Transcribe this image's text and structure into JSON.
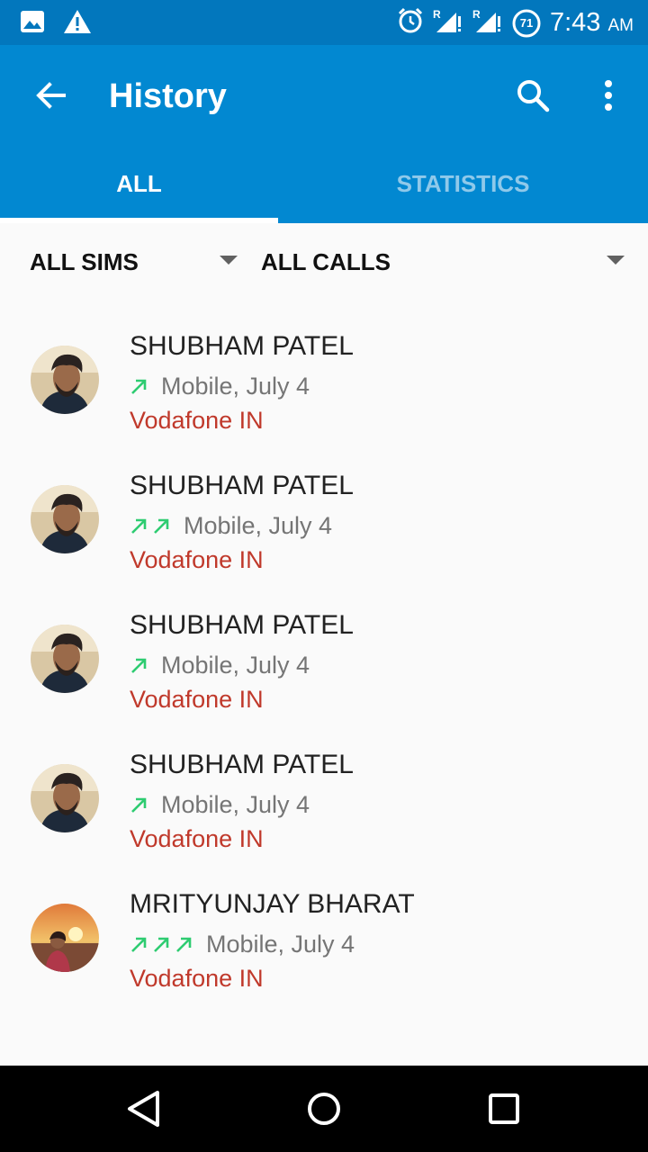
{
  "status_bar": {
    "time": "7:43",
    "ampm": "AM",
    "battery_level": "71",
    "left_icons": [
      "image-icon",
      "warning-icon"
    ],
    "right_icons": [
      "alarm-icon",
      "signal-icon",
      "signal-icon",
      "battery-icon"
    ]
  },
  "app_bar": {
    "title": "History",
    "icons": [
      "back-arrow-icon",
      "search-icon",
      "more-vert-icon"
    ]
  },
  "tabs": [
    {
      "label": "ALL",
      "selected": true
    },
    {
      "label": "STATISTICS",
      "selected": false
    }
  ],
  "filters": {
    "sims": "ALL SIMS",
    "calls": "ALL CALLS"
  },
  "calls": [
    {
      "name": "",
      "arrow_count": 2,
      "detail": "Mobile, July 4",
      "carrier": "Vodafone IN",
      "avatar": "sunset-photo"
    },
    {
      "name": "SHUBHAM PATEL",
      "arrow_count": 1,
      "detail": "Mobile, July 4",
      "carrier": "Vodafone IN",
      "avatar": "man-photo"
    },
    {
      "name": "SHUBHAM PATEL",
      "arrow_count": 2,
      "detail": "Mobile, July 4",
      "carrier": "Vodafone IN",
      "avatar": "man-photo"
    },
    {
      "name": "SHUBHAM PATEL",
      "arrow_count": 1,
      "detail": "Mobile, July 4",
      "carrier": "Vodafone IN",
      "avatar": "man-photo"
    },
    {
      "name": "SHUBHAM PATEL",
      "arrow_count": 1,
      "detail": "Mobile, July 4",
      "carrier": "Vodafone IN",
      "avatar": "man-photo"
    },
    {
      "name": "MRITYUNJAY BHARAT",
      "arrow_count": 3,
      "detail": "Mobile, July 4",
      "carrier": "Vodafone IN",
      "avatar": "sunset-photo"
    }
  ],
  "nav_bar": {
    "icons": [
      "back-triangle-icon",
      "home-circle-icon",
      "recents-square-icon"
    ]
  },
  "colors": {
    "status_bar": "#0277bd",
    "app_bar": "#0288d1",
    "outgoing_arrow": "#2ecc71",
    "carrier_text": "#c0392b"
  }
}
